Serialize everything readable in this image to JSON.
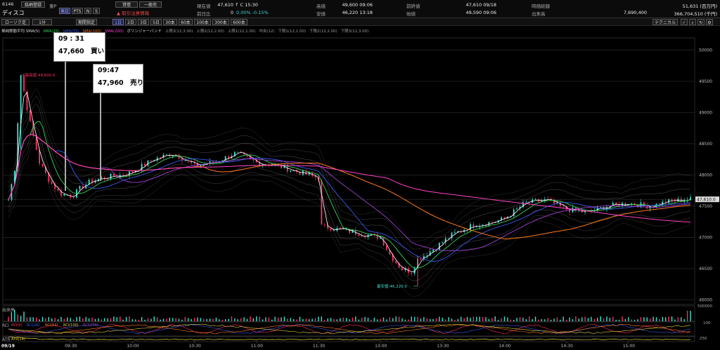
{
  "header": {
    "code": "6146",
    "name": "ディスコ",
    "market": "東P",
    "brand_btn": "銘柄登録",
    "credit_btn": "貸借",
    "general_btn": "一般売",
    "warning": "取引注意情報",
    "tabs": [
      "東証",
      "PTS",
      "N",
      "S"
    ]
  },
  "quotes": [
    {
      "label": "現在値",
      "value": "47,610",
      "extra": "↑ C 15:30"
    },
    {
      "label": "前日比",
      "value": "0",
      "extra": "0.00%  -0.15%"
    },
    {
      "label": "高値",
      "value": "49,600 09:06"
    },
    {
      "label": "安値",
      "value": "46,220 13:18"
    },
    {
      "label": "前終値",
      "value": "47,610 09/18"
    },
    {
      "label": "始値",
      "value": "49,590 09:06"
    },
    {
      "label": "時価総額",
      "value": "51,631 (百万円)"
    },
    {
      "label": "出来高",
      "value": "7,690,400"
    },
    {
      "label": "",
      "value": "366,704,510 (千円)"
    }
  ],
  "toolbar": {
    "chart_type": "ローソク足",
    "interval": "1分",
    "period_select": "期間指定",
    "periods": [
      "1日",
      "2日",
      "3日",
      "5日",
      "30本",
      "60本",
      "100本",
      "300本",
      "600本"
    ],
    "tech_btn": "テクニカル"
  },
  "legend": [
    "単純移動平均 SMA(5)",
    "SMA(25)",
    "SMA(75)",
    "SMA(100)",
    "SMA(200)",
    "ボリンジャーバンド",
    "上限3(12,3.00)",
    "上限2(12,2.00)",
    "上限1(12,1.00)",
    "中央(12)",
    "下限1(12,1.00)",
    "下限2(12,2.00)",
    "下限3(12,3.00)"
  ],
  "annotations": [
    {
      "time": "09 : 31",
      "text": "47,660　買い"
    },
    {
      "time": "09:47",
      "text": "47,960　売り"
    }
  ],
  "price_labels": {
    "high": "最高値:49,600.0",
    "low": "最安値:46,220.0",
    "last": "47,610.0"
  },
  "subpanels": {
    "volume": "出来高",
    "rci": "RCI",
    "rci_legend": [
      "RCI(9)",
      "RCI(26)",
      "RCI(52)",
      "RCI(100)",
      "RCI(200)"
    ],
    "atr": "ATR",
    "atr_legend": "ATR(14)",
    "vol_axis": "500000",
    "rci_axis": "100",
    "atr_axis": "250"
  },
  "colors": {
    "up": "#3fe2d0",
    "down": "#ff3060",
    "sma5": "#ffffff",
    "sma25": "#36d35a",
    "sma75": "#3a58e8",
    "sma100": "#a040d0",
    "sma200": "#ff7a1a",
    "sma_long": "#ff40c8",
    "band": "#777777"
  },
  "chart_data": {
    "type": "line",
    "title": "",
    "xlabel": "",
    "ylabel": "",
    "x_ticks": [
      "09/19",
      "09:30",
      "10:00",
      "10:30",
      "11:00",
      "11:30",
      "13:00",
      "13:30",
      "14:00",
      "14:30",
      "15:00"
    ],
    "ylim": [
      45950,
      50150
    ],
    "y_ticks": [
      46000,
      46500,
      47000,
      47500,
      48000,
      48500,
      49000,
      49500,
      50000
    ],
    "series": [
      {
        "name": "price",
        "x": [
          900,
          903,
          906,
          910,
          915,
          920,
          925,
          931,
          935,
          940,
          947,
          955,
          1000,
          1010,
          1020,
          1030,
          1040,
          1050,
          1100,
          1110,
          1120,
          1130,
          1135,
          1140,
          1145,
          1150,
          1300,
          1305,
          1310,
          1315,
          1318,
          1325,
          1335,
          1345,
          1355,
          1400,
          1410,
          1420,
          1430,
          1440,
          1450,
          1500,
          1510,
          1520,
          1530
        ],
        "values": [
          47600,
          48100,
          49600,
          48900,
          48200,
          47900,
          47700,
          47660,
          47800,
          47900,
          47960,
          48000,
          48050,
          48250,
          48350,
          48150,
          48200,
          48350,
          48200,
          48150,
          48050,
          47950,
          47650,
          47700,
          47600,
          47450,
          47000,
          46700,
          46500,
          46450,
          46650,
          46800,
          47050,
          47200,
          47250,
          47300,
          47550,
          47600,
          47450,
          47400,
          47500,
          47550,
          47500,
          47580,
          47610
        ]
      }
    ]
  }
}
